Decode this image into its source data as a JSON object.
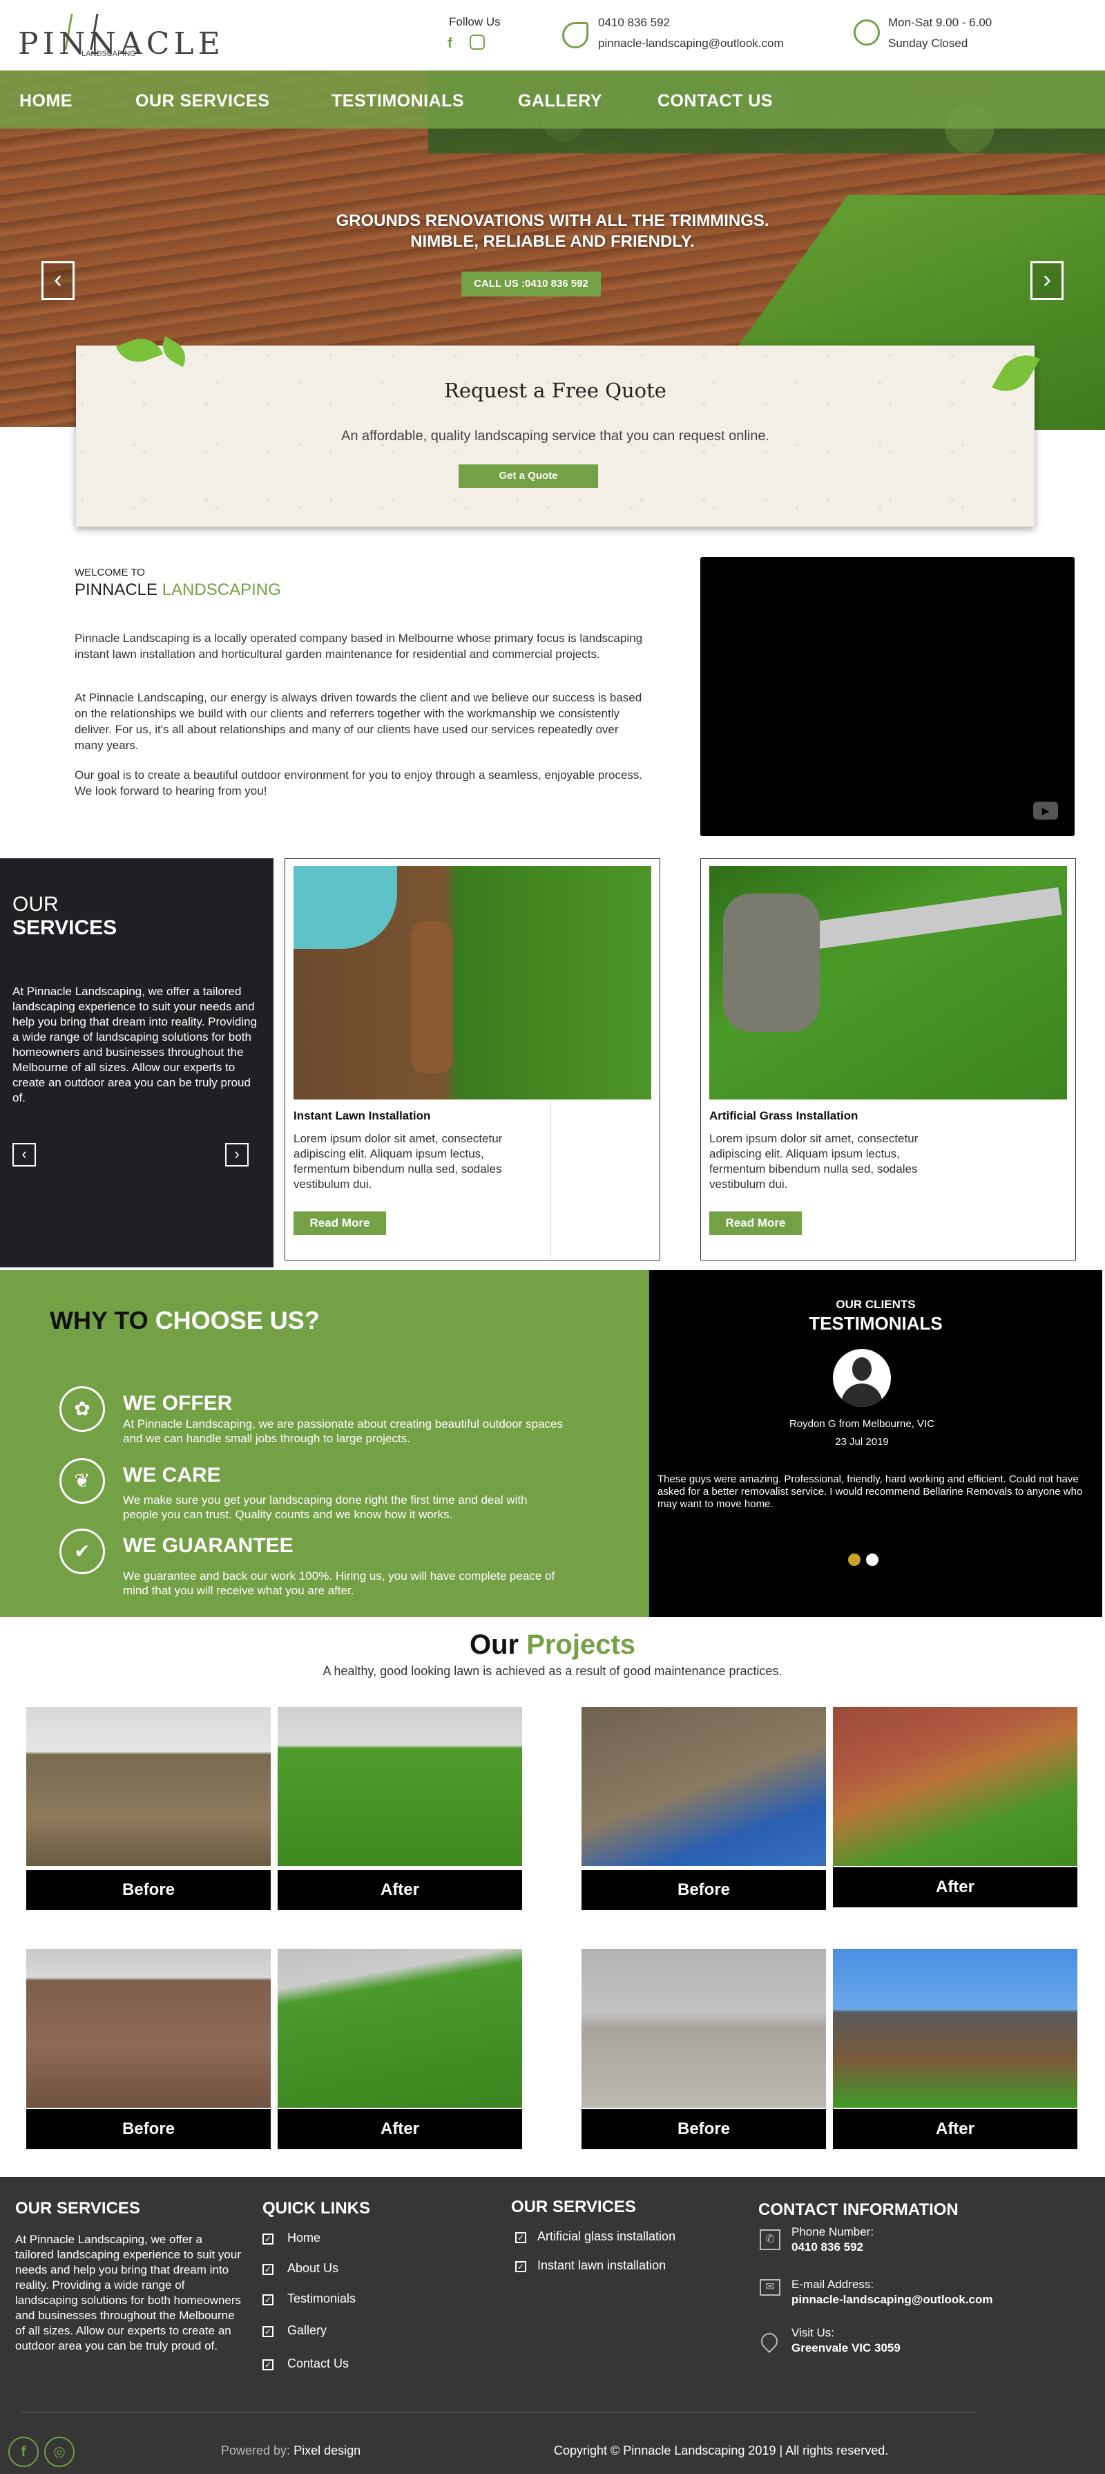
{
  "brand": {
    "logo_word": "PINNACLE",
    "logo_sub": "LANDSCAPING",
    "accent": "#74a046",
    "dark": "#1f2023"
  },
  "topbar": {
    "follow_label": "Follow Us",
    "phone": "0410 836 592",
    "email": "pinnacle-landscaping@outlook.com",
    "hours": "Mon-Sat 9.00 - 6.00",
    "closed": "Sunday Closed"
  },
  "nav": {
    "items": [
      "HOME",
      "OUR SERVICES",
      "TESTIMONIALS",
      "GALLERY",
      "CONTACT US"
    ]
  },
  "hero": {
    "line1": "GROUNDS RENOVATIONS WITH ALL THE TRIMMINGS.",
    "line2": "NIMBLE, RELIABLE AND FRIENDLY.",
    "call_btn": "CALL US :0410 836 592",
    "prev": "‹",
    "next": "›"
  },
  "quote": {
    "title": "Request a Free Quote",
    "subtitle": "An affordable, quality landscaping service that you can request online.",
    "button": "Get a Quote"
  },
  "welcome": {
    "small": "WELCOME TO",
    "big_plain": "PINNACLE ",
    "big_green": "LANDSCAPING",
    "p1": "Pinnacle Landscaping is a locally operated company based in Melbourne whose primary focus is landscaping instant lawn installation and horticultural garden maintenance for residential and commercial projects.",
    "p2": "At Pinnacle Landscaping, our energy is always driven towards the client and we believe our success is based on the relationships we build with our clients and referrers together with the workmanship we consistently deliver. For us, it's all about relationships and many of our clients have used our services repeatedly over many years.",
    "p3": "Our goal is to create a beautiful outdoor environment for you to enjoy through a seamless, enjoyable process. We look forward to hearing from you!"
  },
  "services": {
    "our": "OUR",
    "heading": "SERVICES",
    "text": "At Pinnacle Landscaping, we offer a tailored landscaping experience to suit your needs and help you bring that dream into reality. Providing a wide range of landscaping solutions for both homeowners and businesses throughout the Melbourne of all sizes. Allow our experts to create an outdoor area you can be truly proud of.",
    "prev": "‹",
    "next": "›",
    "cards": [
      {
        "title": "Instant Lawn Installation",
        "text": "Lorem ipsum dolor sit amet, consectetur adipiscing elit. Aliquam ipsum lectus, fermentum bibendum nulla sed, sodales vestibulum dui.",
        "button": "Read More"
      },
      {
        "title": "Artificial Grass Installation",
        "text": "Lorem ipsum dolor sit amet, consectetur adipiscing elit. Aliquam ipsum lectus, fermentum bibendum nulla sed, sodales vestibulum dui.",
        "button": "Read More"
      }
    ]
  },
  "why": {
    "title_black": "WHY TO ",
    "title_white": "CHOOSE US?",
    "items": [
      {
        "head": "WE OFFER",
        "text": "At Pinnacle Landscaping, we are passionate about creating beautiful outdoor spaces and we can handle small jobs through to large projects."
      },
      {
        "head": "WE CARE",
        "text": "We make sure you get your landscaping done right the first time and deal with people you can trust. Quality counts and we know how it works."
      },
      {
        "head": "WE GUARANTEE",
        "text": "We guarantee and back our work 100%. Hiring us, you will have complete peace  of mind that you will receive what you are after."
      }
    ]
  },
  "testimonials": {
    "small": "OUR CLIENTS",
    "big": "TESTIMONIALS",
    "author": "Roydon G from Melbourne, VIC",
    "date": "23 Jul 2019",
    "quote": "These guys were amazing. Professional, friendly, hard working and efficient. Could not have asked for a better removalist service. I would recommend Bellarine Removals to anyone who may want to move home.",
    "dot_active": "#c9a227",
    "dot_inactive": "#ffffff"
  },
  "projects": {
    "title_black": "Our ",
    "title_green": "Projects",
    "subtitle": "A healthy, good looking lawn is achieved as a result of good maintenance practices.",
    "labels": [
      "Before",
      "After",
      "Before",
      "After",
      "Before",
      "After",
      "Before",
      "After"
    ]
  },
  "footer": {
    "col1_head": "OUR SERVICES",
    "col1_text": "At Pinnacle Landscaping, we offer a  tailored landscaping experience to suit your needs and help you bring that  dream into reality. Providing a wide range  of landscaping solutions for both homeowners and businesses throughout the Melbourne of all sizes. Allow our experts to create an outdoor area you can be truly proud of.",
    "col2_head": "QUICK LINKS",
    "quick_links": [
      "Home",
      "About Us",
      "Testimonials",
      "Gallery",
      "Contact Us"
    ],
    "col3_head": "OUR SERVICES",
    "service_links": [
      "Artificial glass installation",
      "Instant lawn installation"
    ],
    "col4_head": "CONTACT INFORMATION",
    "phone_label": "Phone Number:",
    "phone_value": "0410 836 592",
    "email_label": "E-mail Address:",
    "email_value": "pinnacle-landscaping@outlook.com",
    "visit_label": "Visit Us:",
    "visit_value": "Greenvale VIC 3059",
    "powered_prefix": "Powered by: ",
    "powered_name": "Pixel design",
    "copyright": "Copyright © Pinnacle Landscaping 2019 | All rights reserved."
  }
}
